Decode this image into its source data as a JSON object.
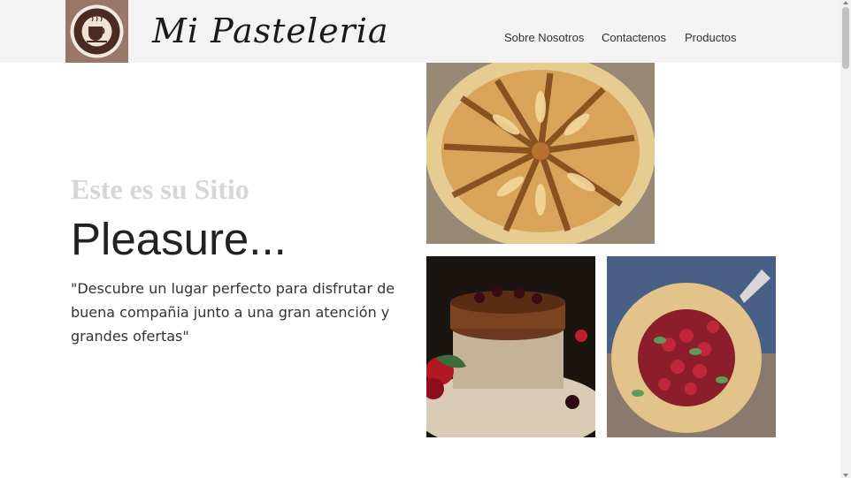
{
  "header": {
    "logo": "coffee-cup-badge-logo",
    "brand": "Mi Pasteleria",
    "nav": [
      {
        "label": "Sobre Nosotros"
      },
      {
        "label": "Contactenos"
      },
      {
        "label": "Productos"
      }
    ]
  },
  "hero": {
    "subtitle": "Este es su Sitio",
    "title": "Pleasure...",
    "quote": "\"Descubre un lugar perfecto para disfrutar de buena compañia junto a una gran atención y grandes ofertas\""
  },
  "gallery": [
    {
      "subject": "apple galette"
    },
    {
      "subject": "chocolate cherry cake"
    },
    {
      "subject": "cherry galette"
    }
  ]
}
